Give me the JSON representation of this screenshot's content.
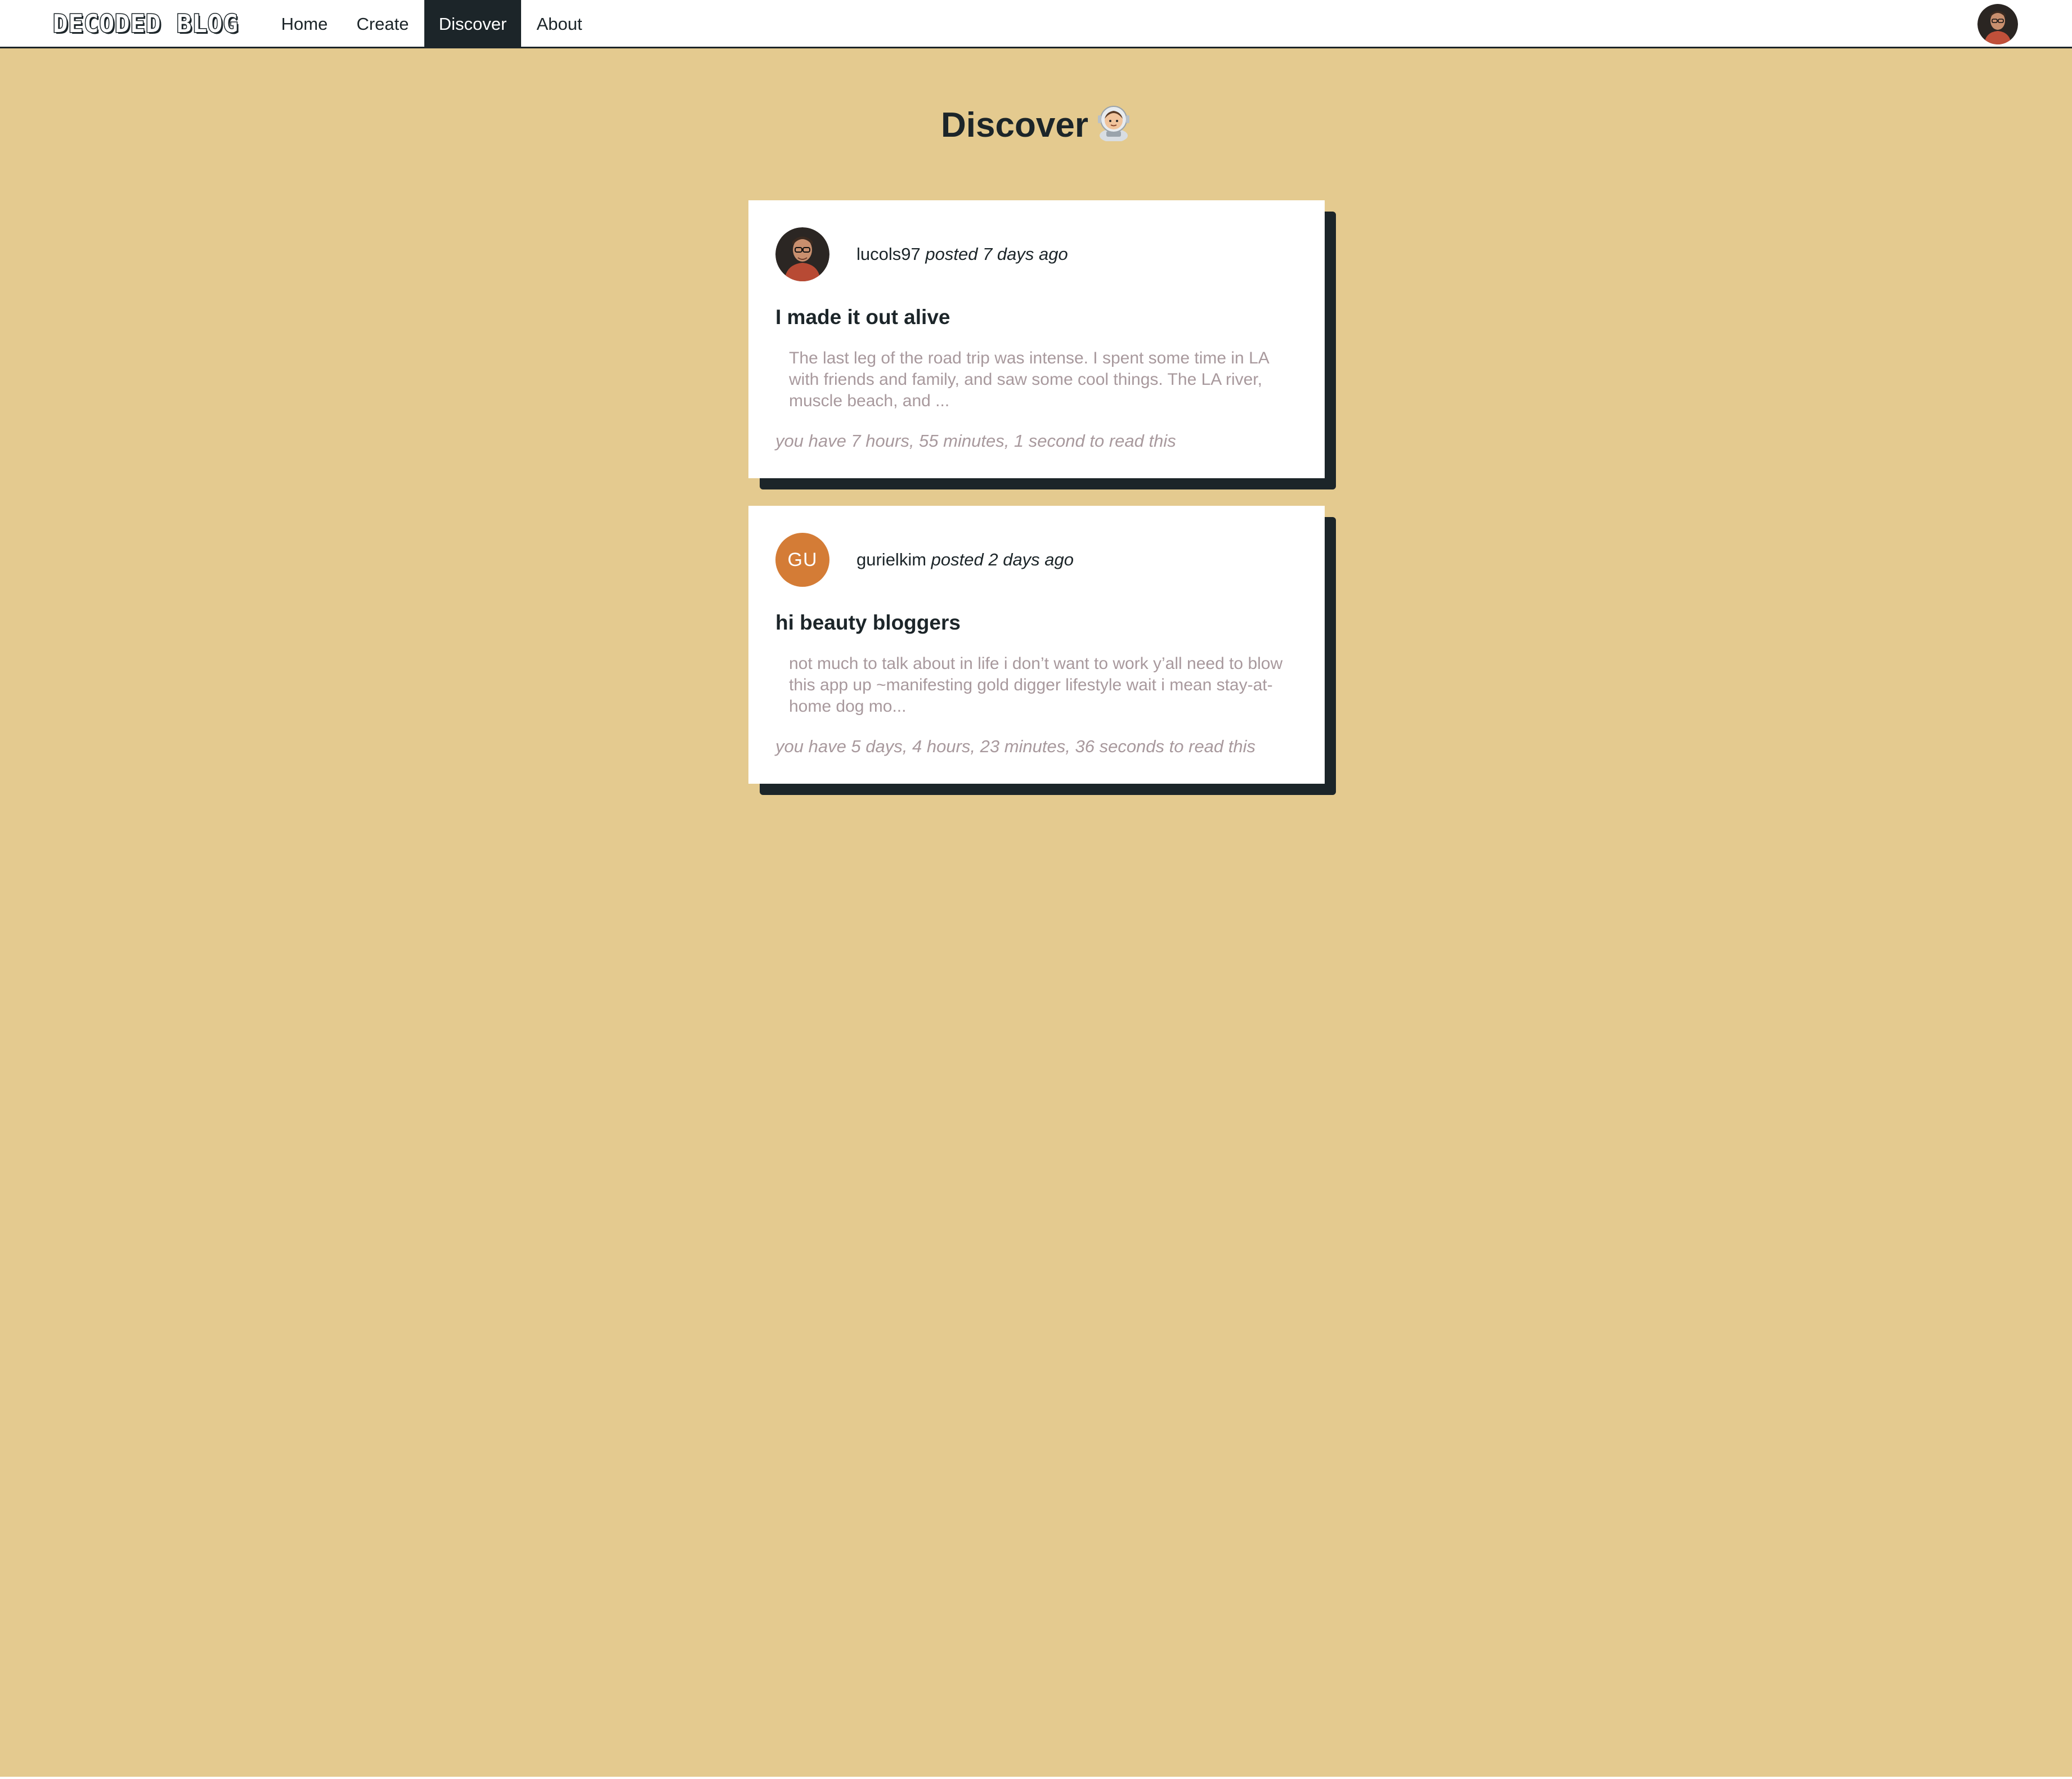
{
  "nav": {
    "brand": "DECODED BLOG",
    "links": [
      {
        "label": "Home",
        "active": false
      },
      {
        "label": "Create",
        "active": false
      },
      {
        "label": "Discover",
        "active": true
      },
      {
        "label": "About",
        "active": false
      }
    ],
    "user_avatar_icon": "user-photo-avatar"
  },
  "page": {
    "title": "Discover",
    "title_icon": "astronaut-emoji-icon"
  },
  "posts": [
    {
      "author": "lucols97",
      "posted": "posted 7 days ago",
      "avatar_type": "photo",
      "title": "I made it out alive",
      "excerpt": "The last leg of the road trip was intense. I spent some time in LA with friends and family, and saw some cool things. The LA river, muscle beach, and ...",
      "read_time": "you have 7 hours, 55 minutes, 1 second to read this"
    },
    {
      "author": "gurielkim",
      "posted": "posted 2 days ago",
      "avatar_type": "initials",
      "avatar_initials": "GU",
      "title": "hi beauty bloggers",
      "excerpt": "not much to talk about in life i don’t want to work y’all need to blow this app up ~manifesting gold digger lifestyle wait i mean stay-at-home dog mo...",
      "read_time": "you have 5 days, 4 hours, 23 minutes, 36 seconds to read this"
    }
  ],
  "colors": {
    "background": "#e4ca8f",
    "dark": "#1c2529",
    "muted_text": "#a8999d",
    "initials_avatar": "#d47c36",
    "card": "#ffffff"
  }
}
